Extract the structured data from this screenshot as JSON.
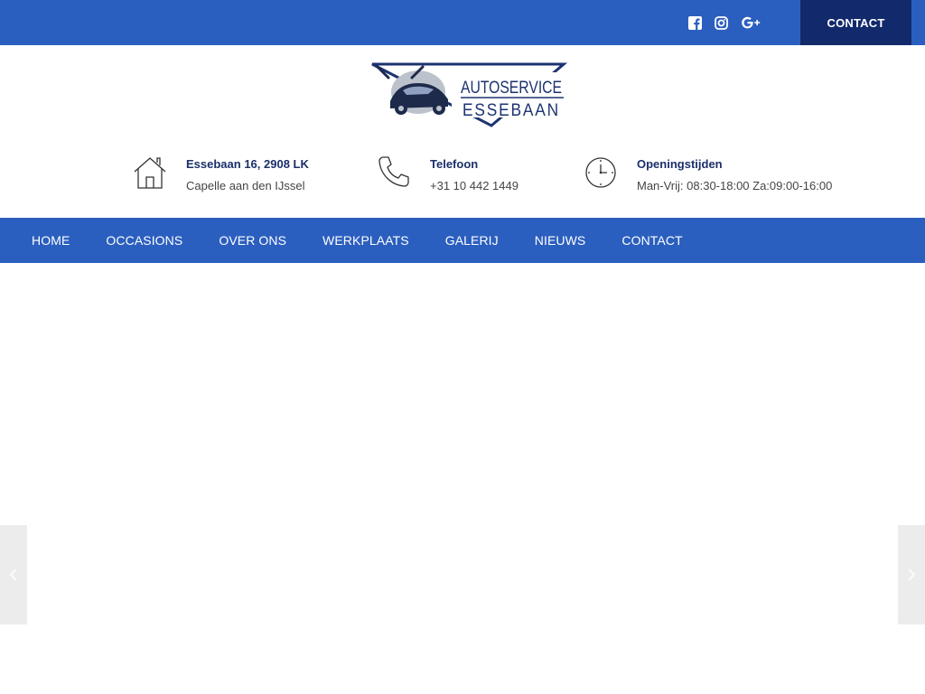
{
  "topbar": {
    "contact_label": "CONTACT",
    "social": [
      {
        "icon": "facebook-icon"
      },
      {
        "icon": "instagram-icon"
      },
      {
        "icon": "google-plus-icon"
      }
    ]
  },
  "logo": {
    "line1": "AUTOSERVICE",
    "line2": "ESSEBAAN"
  },
  "info": {
    "address": {
      "title": "Essebaan 16, 2908 LK",
      "sub": "Capelle aan den IJssel",
      "icon": "house-icon"
    },
    "phone": {
      "title": "Telefoon",
      "sub": "+31 10 442 1449",
      "icon": "phone-icon"
    },
    "hours": {
      "title": "Openingstijden",
      "sub": "Man-Vrij: 08:30-18:00 Za:09:00-16:00",
      "icon": "clock-icon"
    }
  },
  "nav": {
    "items": [
      {
        "label": "HOME"
      },
      {
        "label": "OCCASIONS"
      },
      {
        "label": "OVER ONS"
      },
      {
        "label": "WERKPLAATS"
      },
      {
        "label": "GALERIJ"
      },
      {
        "label": "NIEUWS"
      },
      {
        "label": "CONTACT"
      }
    ]
  },
  "colors": {
    "primary": "#2b5fbf",
    "dark": "#122a6b",
    "heading": "#1b2f6a"
  }
}
